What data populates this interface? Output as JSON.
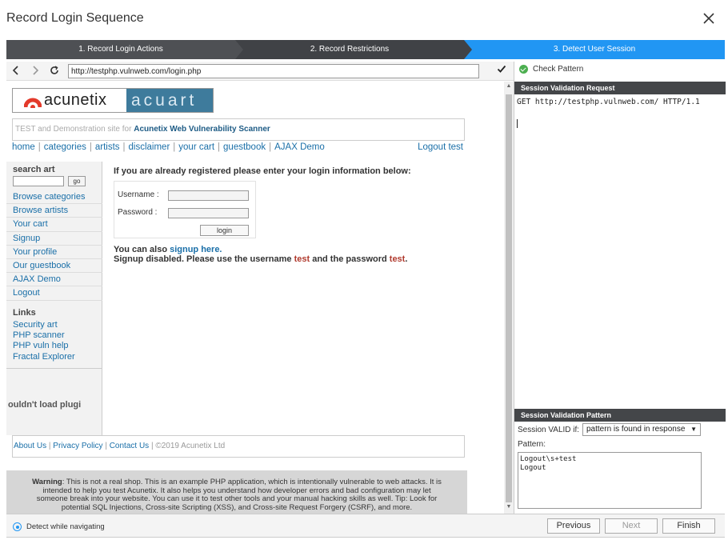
{
  "dialog": {
    "title": "Record Login Sequence"
  },
  "steps": [
    "1. Record Login Actions",
    "2. Record Restrictions",
    "3. Detect User Session"
  ],
  "browser": {
    "url": "http://testphp.vulnweb.com/login.php",
    "icons": {
      "back": "←",
      "forward": "→",
      "reload": "C",
      "go": "✔"
    }
  },
  "site": {
    "logo_left": "acunetix",
    "logo_right": "acuart",
    "tagline_prefix": "TEST and Demonstration site for ",
    "tagline_brand": "Acunetix Web Vulnerability Scanner",
    "nav": [
      "home",
      "categories",
      "artists",
      "disclaimer",
      "your cart",
      "guestbook",
      "AJAX Demo"
    ],
    "logout_link": "Logout test",
    "search_label": "search art",
    "go_label": "go",
    "side_links": [
      "Browse categories",
      "Browse artists",
      "Your cart",
      "Signup",
      "Your profile",
      "Our guestbook",
      "AJAX Demo",
      "Logout"
    ],
    "links_head": "Links",
    "links": [
      "Security art",
      "PHP scanner",
      "PHP vuln help",
      "Fractal Explorer"
    ],
    "plugin_msg": "ouldn't load plugi",
    "intro": "If you are already registered please enter your login information below:",
    "username_label": "Username :",
    "password_label": "Password :",
    "login_btn": "login",
    "also_prefix": "You can also ",
    "also_link": "signup here.",
    "signup_disabled_1": "Signup disabled. Please use the username ",
    "signup_user": "test",
    "signup_disabled_2": " and the password ",
    "signup_pass": "test",
    "signup_end": ".",
    "footer_links": [
      "About Us",
      "Privacy Policy",
      "Contact Us"
    ],
    "footer_copy": "©2019 Acunetix Ltd",
    "warning_bold": "Warning",
    "warning_text": ": This is not a real shop. This is an example PHP application, which is intentionally vulnerable to web attacks. It is intended to help you test Acunetix. It also helps you understand how developer errors and bad configuration may let someone break into your website. You can use it to test other tools and your manual hacking skills as well. Tip: Look for potential SQL Injections, Cross-site Scripting (XSS), and Cross-site Request Forgery (CSRF), and more."
  },
  "panel": {
    "check_pattern": "Check Pattern",
    "request_header": "Session Validation Request",
    "request_text": "GET http://testphp.vulnweb.com/ HTTP/1.1",
    "pattern_header": "Session Validation Pattern",
    "valid_label": "Session VALID if:",
    "valid_option": "pattern is found in response",
    "pattern_label": "Pattern:",
    "pattern_text": "Logout\\s+test\nLogout"
  },
  "footer": {
    "detect": "Detect while navigating",
    "previous": "Previous",
    "next": "Next",
    "finish": "Finish"
  }
}
